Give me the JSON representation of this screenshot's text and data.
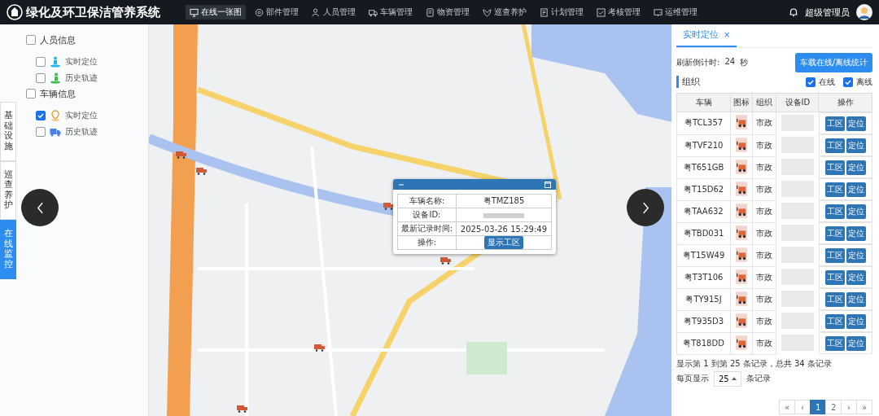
{
  "header": {
    "title": "绿化及环卫保洁管养系统",
    "nav": [
      {
        "label": "在线一张图",
        "selected": true
      },
      {
        "label": "部件管理",
        "selected": false
      },
      {
        "label": "人员管理",
        "selected": false
      },
      {
        "label": "车辆管理",
        "selected": false
      },
      {
        "label": "物资管理",
        "selected": false
      },
      {
        "label": "巡查养护",
        "selected": false
      },
      {
        "label": "计划管理",
        "selected": false
      },
      {
        "label": "考核管理",
        "selected": false
      },
      {
        "label": "运维管理",
        "selected": false
      }
    ],
    "user": "超级管理员"
  },
  "layers": [
    {
      "label": "人员信息",
      "checked": false,
      "children": [
        {
          "label": "实时定位",
          "checked": false
        },
        {
          "label": "历史轨迹",
          "checked": false
        }
      ]
    },
    {
      "label": "车辆信息",
      "checked": false,
      "children": [
        {
          "label": "实时定位",
          "checked": true
        },
        {
          "label": "历史轨迹",
          "checked": false
        }
      ]
    }
  ],
  "side_tabs": [
    {
      "label": "基础设施",
      "selected": false
    },
    {
      "label": "巡查养护",
      "selected": false
    },
    {
      "label": "在线监控",
      "selected": true
    }
  ],
  "popup": {
    "rows": [
      {
        "label": "车辆名称:",
        "kind": "text",
        "value": "粤TMZ185"
      },
      {
        "label": "设备ID:",
        "kind": "redacted"
      },
      {
        "label": "最新记录时间:",
        "kind": "text",
        "value": "2025-03-26 15:29:49"
      },
      {
        "label": "操作:",
        "kind": "button",
        "value": "显示工区"
      }
    ]
  },
  "panel": {
    "tab": {
      "label": "实时定位",
      "close": "×",
      "selected": true
    },
    "countdown_label": "刷新倒计时:",
    "countdown_value": "24",
    "countdown_unit": "秒",
    "stats_button": "车载在线/离线统计",
    "section": "组织",
    "filters": [
      {
        "label": "在线",
        "checked": true
      },
      {
        "label": "离线",
        "checked": true
      }
    ],
    "columns": [
      "车辆",
      "图标",
      "组织",
      "设备ID",
      "操作"
    ],
    "rows": [
      {
        "plate": "粤TCL357",
        "org": "市政",
        "actions": [
          "工区",
          "定位"
        ]
      },
      {
        "plate": "粤TVF210",
        "org": "市政",
        "actions": [
          "工区",
          "定位"
        ]
      },
      {
        "plate": "粤T651GB",
        "org": "市政",
        "actions": [
          "工区",
          "定位"
        ]
      },
      {
        "plate": "粤T15D62",
        "org": "市政",
        "actions": [
          "工区",
          "定位"
        ]
      },
      {
        "plate": "粤TAA632",
        "org": "市政",
        "actions": [
          "工区",
          "定位"
        ]
      },
      {
        "plate": "粤TBD031",
        "org": "市政",
        "actions": [
          "工区",
          "定位"
        ]
      },
      {
        "plate": "粤T15W49",
        "org": "市政",
        "actions": [
          "工区",
          "定位"
        ]
      },
      {
        "plate": "粤T3T106",
        "org": "市政",
        "actions": [
          "工区",
          "定位"
        ]
      },
      {
        "plate": "粤TY915J",
        "org": "市政",
        "actions": [
          "工区",
          "定位"
        ]
      },
      {
        "plate": "粤T935D3",
        "org": "市政",
        "actions": [
          "工区",
          "定位"
        ]
      },
      {
        "plate": "粤T818DD",
        "org": "市政",
        "actions": [
          "工区",
          "定位"
        ]
      }
    ],
    "summary": "显示第 1 到第 25 条记录，总共 34 条记录",
    "page_size_label": "每页显示",
    "page_size": "25",
    "page_size_suffix": "条记录",
    "pages": [
      {
        "label": "«",
        "selected": false
      },
      {
        "label": "‹",
        "selected": false
      },
      {
        "label": "1",
        "selected": true
      },
      {
        "label": "2",
        "selected": false
      },
      {
        "label": "›",
        "selected": false
      },
      {
        "label": "»",
        "selected": false
      }
    ]
  }
}
